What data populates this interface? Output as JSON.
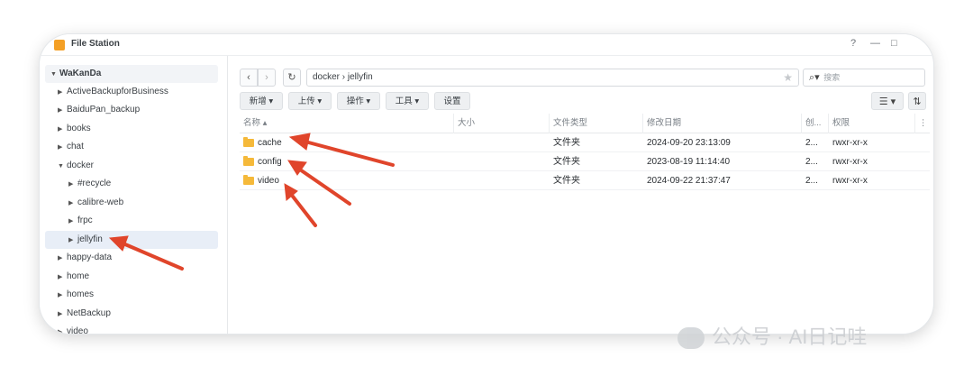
{
  "window": {
    "title": "File Station",
    "help": "?",
    "minimize": "—",
    "maximize": "□"
  },
  "sidebar": {
    "root": "WaKanDa",
    "items": [
      {
        "label": "ActiveBackupforBusiness"
      },
      {
        "label": "BaiduPan_backup"
      },
      {
        "label": "books"
      },
      {
        "label": "chat"
      },
      {
        "label": "docker"
      },
      {
        "label": "#recycle"
      },
      {
        "label": "calibre-web"
      },
      {
        "label": "frpc"
      },
      {
        "label": "jellyfin"
      },
      {
        "label": "happy-data"
      },
      {
        "label": "home"
      },
      {
        "label": "homes"
      },
      {
        "label": "NetBackup"
      },
      {
        "label": "video"
      }
    ]
  },
  "toolbar": {
    "path": "docker › jellyfin",
    "search_placeholder": "搜索",
    "new_label": "新增 ▾",
    "upload_label": "上传 ▾",
    "action_label": "操作 ▾",
    "tools_label": "工具 ▾",
    "settings_label": "设置"
  },
  "table": {
    "headers": {
      "name": "名称 ▴",
      "size": "大小",
      "type": "文件类型",
      "modified": "修改日期",
      "created": "创...",
      "perm": "权限",
      "more": "⋮"
    },
    "rows": [
      {
        "name": "cache",
        "size": "",
        "type": "文件夹",
        "modified": "2024-09-20 23:13:09",
        "created": "2...",
        "perm": "rwxr-xr-x"
      },
      {
        "name": "config",
        "size": "",
        "type": "文件夹",
        "modified": "2023-08-19 11:14:40",
        "created": "2...",
        "perm": "rwxr-xr-x"
      },
      {
        "name": "video",
        "size": "",
        "type": "文件夹",
        "modified": "2024-09-22 21:37:47",
        "created": "2...",
        "perm": "rwxr-xr-x"
      }
    ]
  },
  "watermark": {
    "text": "公众号 · AI日记哇"
  },
  "colors": {
    "annotation_arrow": "#e0452b",
    "folder": "#f5b93a"
  }
}
